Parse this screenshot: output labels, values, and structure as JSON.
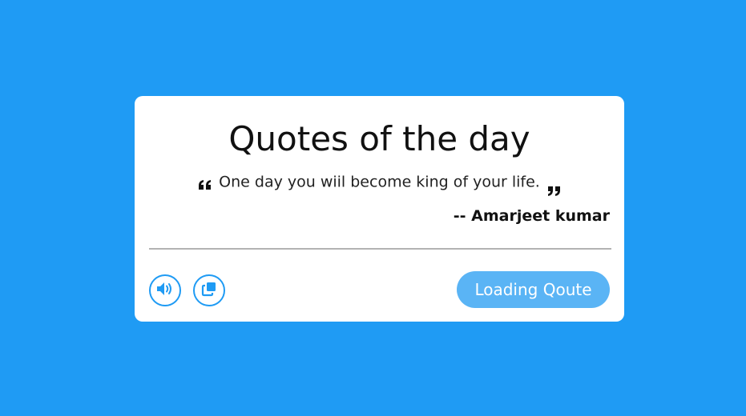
{
  "card": {
    "title": "Quotes of the day",
    "quote_text": "One day you wiil become king of your life.",
    "author": "-- Amarjeet kumar"
  },
  "icons": {
    "open_quote": "quote-left-icon",
    "close_quote": "quote-right-icon",
    "sound": "volume-up-icon",
    "copy": "copy-icon"
  },
  "actions": {
    "load_button_label": "Loading Qoute"
  },
  "colors": {
    "background": "#1f9bf4",
    "accent": "#1f9bf4",
    "button_fill": "#5ab4f5",
    "card": "#ffffff"
  }
}
